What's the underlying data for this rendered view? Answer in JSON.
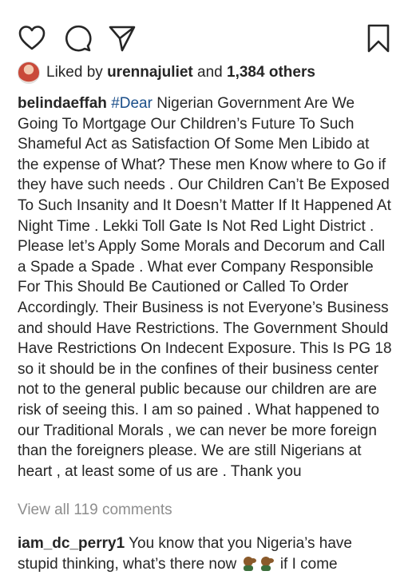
{
  "actions": {
    "icons": [
      "heart-icon",
      "comment-icon",
      "share-icon",
      "bookmark-icon"
    ]
  },
  "likes": {
    "prefix": "Liked by",
    "user": "urennajuliet",
    "connector": "and",
    "others": "1,384 others"
  },
  "caption": {
    "username": "belindaeffah",
    "hashtag": "#Dear",
    "text": "Nigerian Government Are We Going To Mortgage Our Children’s Future To Such Shameful Act as Satisfaction Of Some Men Libido at the expense of What? These men Know where to Go if they have such needs . Our Children Can’t Be Exposed To Such Insanity and It Doesn’t Matter If It Happened At Night Time . Lekki Toll Gate Is Not Red Light District . Please let’s Apply Some Morals and Decorum and Call a Spade a Spade . What ever Company Responsible For This Should Be Cautioned or Called To Order Accordingly. Their Business is not Everyone’s Business and should Have Restrictions. The Government Should Have Restrictions On Indecent Exposure. This Is PG 18 so it should be in the confines of their business center not to the general public because our children are are risk of seeing this. I am so pained . What happened to our Traditional Morals , we can never be more foreign than the foreigners please. We are still Nigerians at heart , at least some of us are . Thank you"
  },
  "comments_link": "View all 119 comments",
  "top_comment": {
    "username": "iam_dc_perry1",
    "text_before_emoji": "You know that you Nigeria’s have stupid thinking, what’s there now",
    "text_after_emoji": "if I come"
  },
  "colors": {
    "text": "#262626",
    "muted": "#8e8e8e",
    "hashtag": "#1b4f8a"
  }
}
